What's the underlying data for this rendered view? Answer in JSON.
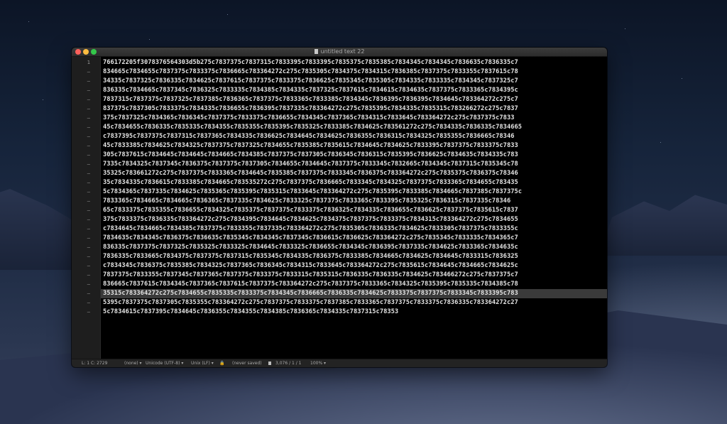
{
  "window": {
    "title": "untitled text 22"
  },
  "gutter": {
    "line_number": "1",
    "wrap_marker": "–"
  },
  "editor": {
    "lines": [
      "766172205f3078376564303d5b275c7837375c7837315c7833395c7833395c7835375c7835385c7834345c7834345c7836635c7836335c7",
      "834665c7834655c7837375c7833375c7836665c783364272c275c7835305c7834375c7834315c7836385c7837375c7833355c7837615c78",
      "34335c7837325c7836335c7834625c7837615c7837375c7833375c7836625c7835345c7835305c7834335c7833335c7834345c7837325c7",
      "836335c7834665c7837345c7836325c7833335c7834385c7834335c7837325c7837615c7834615c7834635c7837375c7833365c7834395c",
      "7837315c7837375c7837325c7837385c7836365c7837375c7833365c7833385c7834345c7836395c7836395c7834645c783364272c275c7",
      "837375c7837305c7833375c7834335c7836655c7836395c7837335c783364272c275c7835395c7834335c7835315c783266272c275c7837",
      "375c7837325c7834365c7836345c7837375c7833375c7836655c7834345c7837365c7834315c7833645c783364272c275c7837375c7833",
      "45c7834655c7836335c7835335c7834355c7835355c7835395c7835325c7833385c7834625c783561272c275c7834335c7836335c7834665",
      "c7837395c7837375c7837315c7837365c7834335c7836625c7834645c7834625c7836355c7836315c7834325c7835355c7836665c78346",
      "45c7833385c7834625c7834325c7837375c7837325c7834655c7835385c7835615c7834645c7834625c7833395c7837375c7833375c7833",
      "305c7837615c7834645c7834645c7834665c7834385c7837375c7837305c7836345c7836315c7835395c7836625c7834635c7834335c783",
      "7335c7834325c7837345c7836375c7837375c7837305c7834655c7834645c7837375c7833345c7832665c7834345c7837315c7835345c78",
      "35325c783661272c275c7837375c7833365c7834645c7835385c7837375c7833345c7836375c783364272c275c7835375c7836375c78346",
      "35c7834335c7836615c7833385c7834665c783535272c275c7837375c7836665c7833345c7834325c7837375c7833365c7834655c783435",
      "5c7834365c7837335c7834625c7835365c7835395c7835315c7833645c783364272c275c7835395c7833385c7834665c7837385c7837375c",
      "7833365c7834665c7834665c7836365c7837335c7834625c7833325c7837375c7833365c7833395c7835325c7836315c7837335c78346",
      "65c7833375c7835355c7836655c7834325c7835375c7837375c7833375c7836325c7834335c7836655c7836625c7837375c7835615c7837",
      "375c7833375c7836335c783364272c275c7834395c7834645c7834625c7834375c7837375c7833375c7834315c783364272c275c7834655",
      "c7834645c7834665c7834385c7837375c7833355c7837335c783364272c275c7835305c7836335c7834625c7833305c7837375c7833355c",
      "7834635c7834345c7836375c7836635c7835345c7834345c7837345c7836615c7836625c783364272c275c7835345c7833335c7834365c7",
      "836335c7837375c7837325c7835325c7833325c7834645c7833325c7836655c7834345c7836395c7837335c7834625c7833365c7834635c",
      "7836335c7833665c7834375c7837375c7837315c7835345c7834335c7836375c7833385c7834665c7834625c7834645c7833315c7836325",
      "c7834345c7836375c7835385c7834325c7837365c7836345c7834315c7833645c783364272c275c7835615c7834645c7834665c7834625c",
      "7837375c7833355c7837345c7837365c7837375c7833375c7833315c7835315c7836335c7836335c7834625c783466272c275c7837375c7",
      "836665c7837615c7834345c7837365c7837615c7837375c783364272c275c7837375c7833365c7834325c7835395c7835335c7834385c78",
      "35315c783364272c275c7834655c7835335c7833375c7834345c7836665c7836335c7834625c7833375c7837375c7833345c7833395c783",
      "5395c7837375c7837305c7835355c783364272c275c7837375c7833375c7837385c7833365c7837375c7833375c7836335c783364272c27",
      "5c7834615c7837395c7834645c7836355c7834355c7834385c7836365c7834335c7837315c78353"
    ]
  },
  "statusbar": {
    "position": "L: 1 C: 2729",
    "syntax": "(none) ▾",
    "encoding": "Unicode (UTF-8) ▾",
    "line_endings": "Unix (LF) ▾",
    "save_state": "(never saved)",
    "stats": "3,076 / 1 / 1",
    "zoom": "100% ▾"
  }
}
